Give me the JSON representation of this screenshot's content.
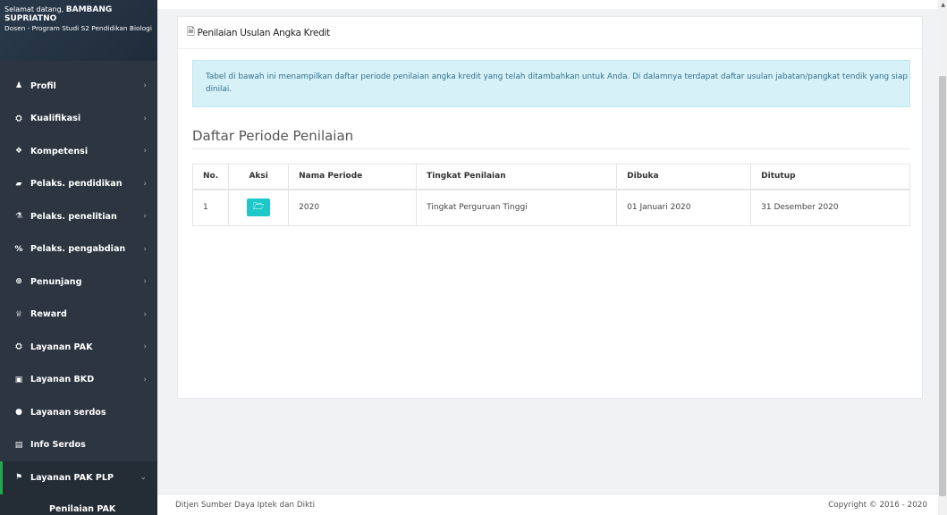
{
  "user": {
    "welcome_prefix": "Selamat datang, ",
    "name": "BAMBANG SUPRIATNO",
    "role": "Dosen - Program Studi S2 Pendidikan Biologi"
  },
  "menu": [
    {
      "label": "Profil",
      "icon": "user-icon",
      "glyph": "♟"
    },
    {
      "label": "Kualifikasi",
      "icon": "graduation-cap-icon",
      "glyph": "⛭"
    },
    {
      "label": "Kompetensi",
      "icon": "cubes-icon",
      "glyph": "❖"
    },
    {
      "label": "Pelaks. pendidikan",
      "icon": "book-icon",
      "glyph": "▰"
    },
    {
      "label": "Pelaks. penelitian",
      "icon": "flask-icon",
      "glyph": "⚗"
    },
    {
      "label": "Pelaks. pengabdian",
      "icon": "percent-icon",
      "glyph": "%"
    },
    {
      "label": "Penunjang",
      "icon": "support-icon",
      "glyph": "⊕"
    },
    {
      "label": "Reward",
      "icon": "trophy-icon",
      "glyph": "♕"
    },
    {
      "label": "Layanan PAK",
      "icon": "graduation-cap-icon",
      "glyph": "⛭"
    },
    {
      "label": "Layanan BKD",
      "icon": "briefcase-icon",
      "glyph": "▣"
    },
    {
      "label": "Layanan serdos",
      "icon": "circle-icon",
      "glyph": "●"
    },
    {
      "label": "Info Serdos",
      "icon": "id-card-icon",
      "glyph": "▤"
    },
    {
      "label": "Layanan PAK PLP",
      "icon": "flag-icon",
      "glyph": "⚑"
    }
  ],
  "submenu": {
    "label": "Penilaian PAK"
  },
  "card": {
    "title": "Penilaian Usulan Angka Kredit",
    "alert": "Tabel di bawah ini menampilkan daftar periode penilaian angka kredit yang telah ditambahkan untuk Anda. Di dalamnya terdapat daftar usulan jabatan/pangkat tendik yang siap dinilai.",
    "section_title": "Daftar Periode Penilaian"
  },
  "table": {
    "headers": [
      "No.",
      "Aksi",
      "Nama Periode",
      "Tingkat Penilaian",
      "Dibuka",
      "Ditutup"
    ],
    "rows": [
      {
        "no": "1",
        "nama": "2020",
        "tingkat": "Tingkat Perguruan Tinggi",
        "dibuka": "01 Januari 2020",
        "ditutup": "31 Desember 2020"
      }
    ]
  },
  "footer": {
    "left": "Ditjen Sumber Daya Iptek dan Dikti",
    "right": "Copyright © 2016 - 2020"
  },
  "colors": {
    "sidebar": "#2c3540",
    "accent": "#1fa84f",
    "action": "#1fc8c8",
    "alert_bg": "#d7f1f8"
  }
}
